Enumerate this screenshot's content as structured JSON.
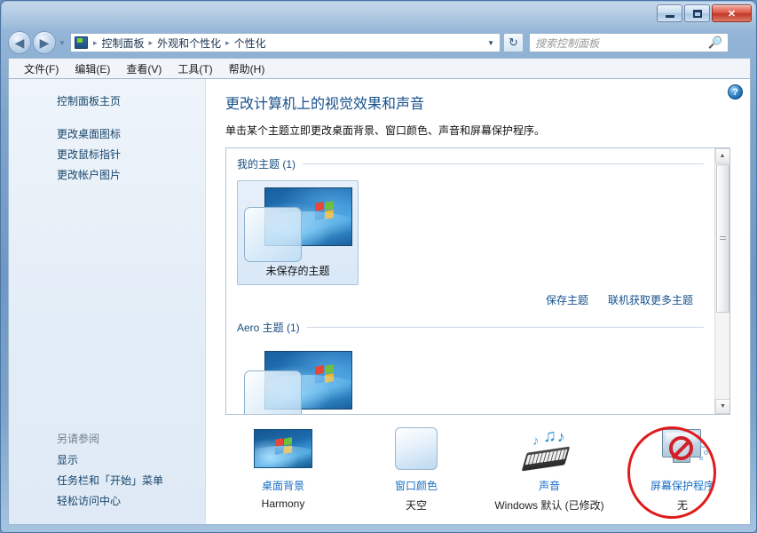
{
  "window": {
    "title": "",
    "buttons": {
      "minimize": "minimize-icon",
      "maximize": "maximize-icon",
      "close": "✕"
    }
  },
  "nav": {
    "back_icon": "◀",
    "forward_icon": "▶",
    "history_icon": "▼",
    "refresh_icon": "↻",
    "dropdown_icon": "▼",
    "breadcrumbs": [
      "控制面板",
      "外观和个性化",
      "个性化"
    ],
    "separator": "▸"
  },
  "search": {
    "placeholder": "搜索控制面板",
    "icon": "search-icon"
  },
  "menu": {
    "items": [
      {
        "label": "文件(F)",
        "accel": "F"
      },
      {
        "label": "编辑(E)",
        "accel": "E"
      },
      {
        "label": "查看(V)",
        "accel": "V"
      },
      {
        "label": "工具(T)",
        "accel": "T"
      },
      {
        "label": "帮助(H)",
        "accel": "H"
      }
    ]
  },
  "sidebar": {
    "home_link": "控制面板主页",
    "links": [
      "更改桌面图标",
      "更改鼠标指针",
      "更改帐户图片"
    ],
    "see_also_header": "另请参阅",
    "see_also_links": [
      "显示",
      "任务栏和「开始」菜单",
      "轻松访问中心"
    ]
  },
  "main": {
    "help_icon": "?",
    "heading": "更改计算机上的视觉效果和声音",
    "subtitle": "单击某个主题立即更改桌面背景、窗口颜色、声音和屏幕保护程序。",
    "groups": [
      {
        "title": "我的主题 (1)",
        "themes": [
          {
            "label": "未保存的主题",
            "selected": true
          }
        ]
      },
      {
        "title": "Aero 主题 (1)",
        "themes": [
          {
            "label": "",
            "selected": false
          }
        ]
      }
    ],
    "links": [
      "保存主题",
      "联机获取更多主题"
    ],
    "scrollbar": {
      "up_arrow": "▲",
      "down_arrow": "▼"
    }
  },
  "personalization_items": [
    {
      "name": "桌面背景",
      "value": "Harmony",
      "icon": "desktop-background-icon",
      "highlighted": false
    },
    {
      "name": "窗口颜色",
      "value": "天空",
      "icon": "window-color-icon",
      "highlighted": false
    },
    {
      "name": "声音",
      "value": "Windows 默认 (已修改)",
      "icon": "sound-icon",
      "highlighted": false
    },
    {
      "name": "屏幕保护程序",
      "value": "无",
      "icon": "screensaver-icon",
      "highlighted": true
    }
  ],
  "annotation": {
    "shape": "ellipse",
    "color": "#e01b1b",
    "target": "屏幕保护程序"
  },
  "colors": {
    "link": "#17518c",
    "heading": "#17518c",
    "accent": "#1a6fc4",
    "annotation": "#e01b1b",
    "sidebar_bg": "#e6eff8"
  }
}
